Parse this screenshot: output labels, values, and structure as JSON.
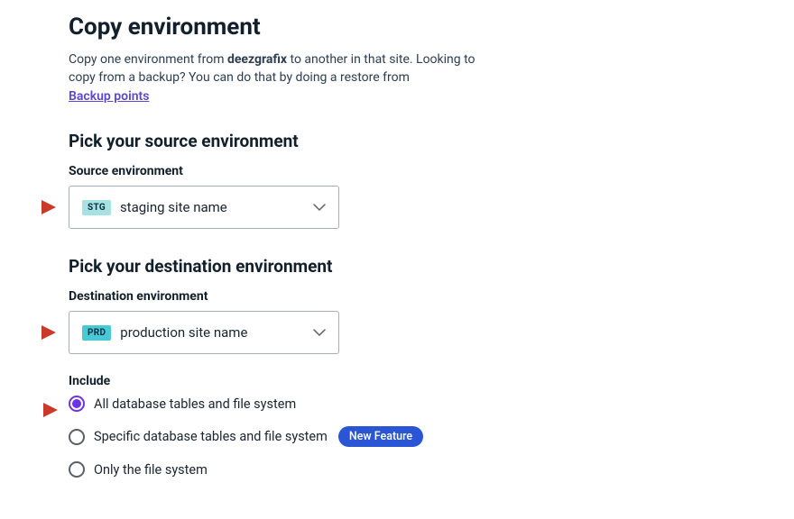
{
  "title": "Copy environment",
  "intro": {
    "line1_prefix": "Copy one environment from ",
    "site_name": "deezgrafix",
    "line1_suffix": " to another in that site. Looking to",
    "line2": "copy from a backup? You can do that by doing a restore from",
    "backup_link": "Backup points"
  },
  "source": {
    "heading": "Pick your source environment",
    "label": "Source environment",
    "badge": "STG",
    "value": "staging site name"
  },
  "destination": {
    "heading": "Pick your destination environment",
    "label": "Destination environment",
    "badge": "PRD",
    "value": "production site name"
  },
  "include": {
    "label": "Include",
    "options": {
      "all": "All database tables and file system",
      "specific": "Specific database tables and file system",
      "files_only": "Only the file system"
    },
    "new_feature_badge": "New Feature"
  }
}
